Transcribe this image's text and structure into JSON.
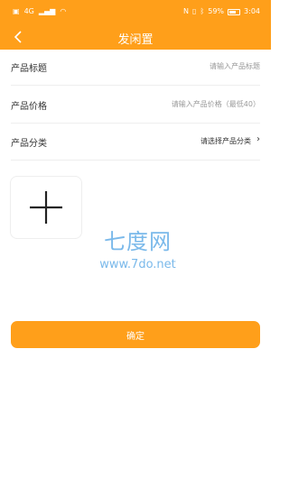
{
  "status_bar": {
    "signal": "4G",
    "battery_percent": "59%",
    "time": "3:04"
  },
  "nav": {
    "title": "发闲置"
  },
  "form": {
    "title_label": "产品标题",
    "title_placeholder": "请输入产品标题",
    "price_label": "产品价格",
    "price_placeholder": "请输入产品价格（最低40）",
    "category_label": "产品分类",
    "category_placeholder": "请选择产品分类"
  },
  "watermark": {
    "main": "七度网",
    "sub": "www.7do.net"
  },
  "confirm_label": "确定",
  "colors": {
    "accent": "#ff9f1a",
    "text": "#333333",
    "placeholder": "#999999"
  }
}
